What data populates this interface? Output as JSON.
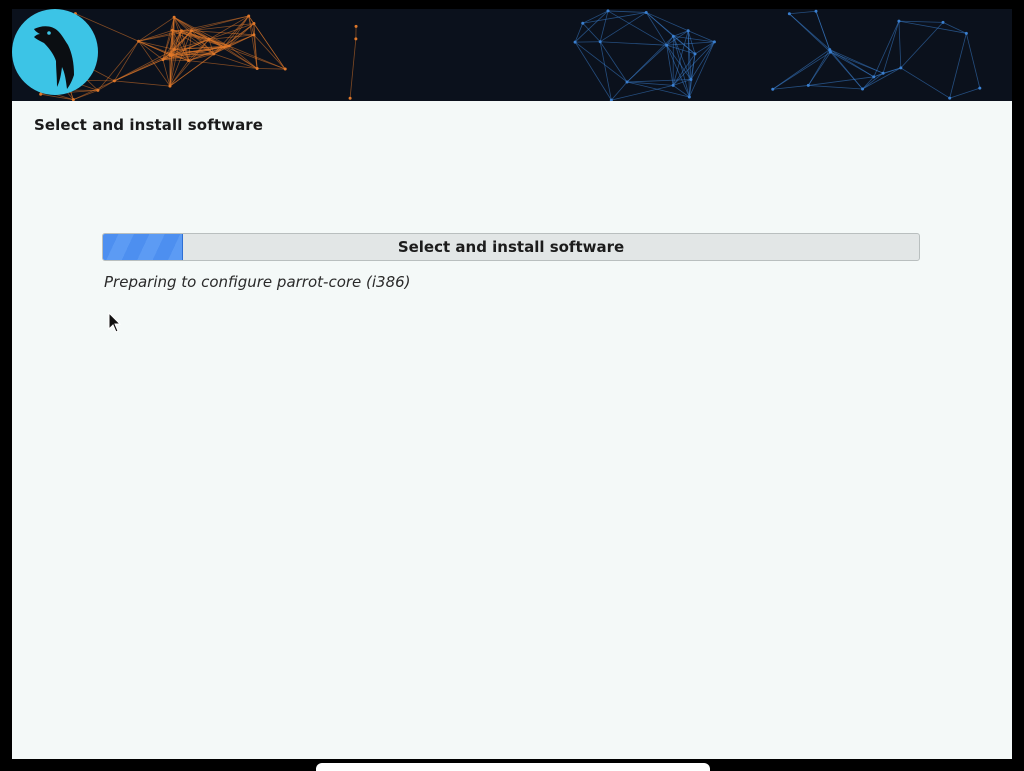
{
  "window": {
    "page_title": "Select and install software"
  },
  "banner": {
    "logo_icon": "parrot-logo-icon",
    "logo_color": "#3cc4e6",
    "background_color": "#0b111c",
    "accent_left": "#e0782a",
    "accent_right": "#3a7fd0"
  },
  "progress": {
    "label": "Select and install software",
    "fraction": 0.098,
    "fill_color": "#4d8ff0"
  },
  "status": {
    "text": "Preparing to configure parrot-core (i386)"
  },
  "pointer": {
    "icon": "mouse-pointer-icon"
  }
}
